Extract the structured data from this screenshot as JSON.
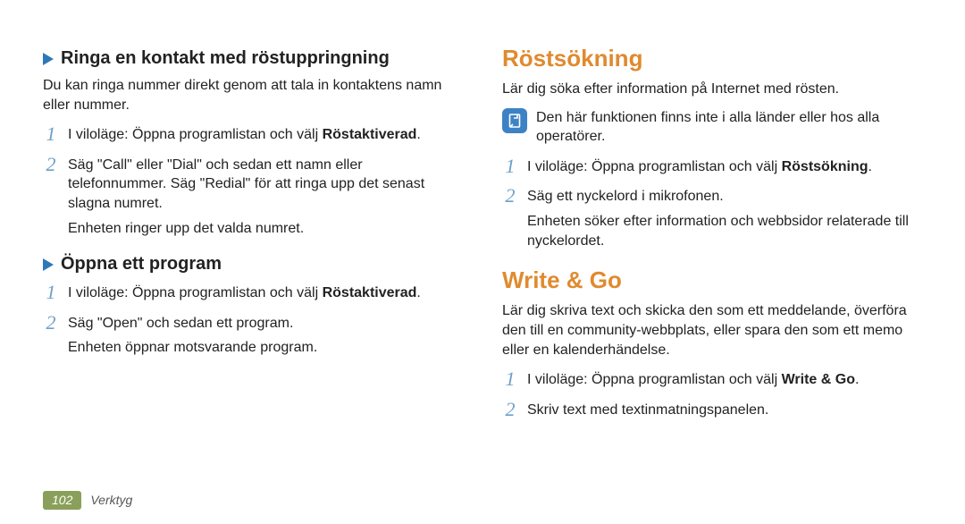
{
  "left": {
    "sec1": {
      "heading": "Ringa en kontakt med röstuppringning",
      "intro": "Du kan ringa nummer direkt genom att tala in kontaktens namn eller nummer.",
      "step1_prefix": "I viloläge: Öppna programlistan och välj ",
      "step1_bold": "Röstaktiverad",
      "step1_suffix": ".",
      "step2_l1": "Säg \"Call\" eller \"Dial\" och sedan ett namn eller telefonnummer. Säg \"Redial\" för att ringa upp det senast slagna numret.",
      "step2_l2": "Enheten ringer upp det valda numret.",
      "num1": "1",
      "num2": "2"
    },
    "sec2": {
      "heading": "Öppna ett program",
      "step1_prefix": "I viloläge: Öppna programlistan och välj ",
      "step1_bold": "Röstaktiverad",
      "step1_suffix": ".",
      "step2_l1": "Säg \"Open\" och sedan ett program.",
      "step2_l2": "Enheten öppnar motsvarande program.",
      "num1": "1",
      "num2": "2"
    }
  },
  "right": {
    "sec1": {
      "title": "Röstsökning",
      "intro": "Lär dig söka efter information på Internet med rösten.",
      "note": "Den här funktionen finns inte i alla länder eller hos alla operatörer.",
      "step1_prefix": "I viloläge: Öppna programlistan och välj ",
      "step1_bold": "Röstsökning",
      "step1_suffix": ".",
      "step2_l1": "Säg ett nyckelord i mikrofonen.",
      "step2_l2": "Enheten söker efter information och webbsidor relaterade till nyckelordet.",
      "num1": "1",
      "num2": "2"
    },
    "sec2": {
      "title": "Write & Go",
      "intro": "Lär dig skriva text och skicka den som ett meddelande, överföra den till en community-webbplats, eller spara den som ett memo eller en kalenderhändelse.",
      "step1_prefix": "I viloläge: Öppna programlistan och välj ",
      "step1_bold": "Write & Go",
      "step1_suffix": ".",
      "step2": "Skriv text med textinmatningspanelen.",
      "num1": "1",
      "num2": "2"
    }
  },
  "footer": {
    "page": "102",
    "section": "Verktyg"
  }
}
